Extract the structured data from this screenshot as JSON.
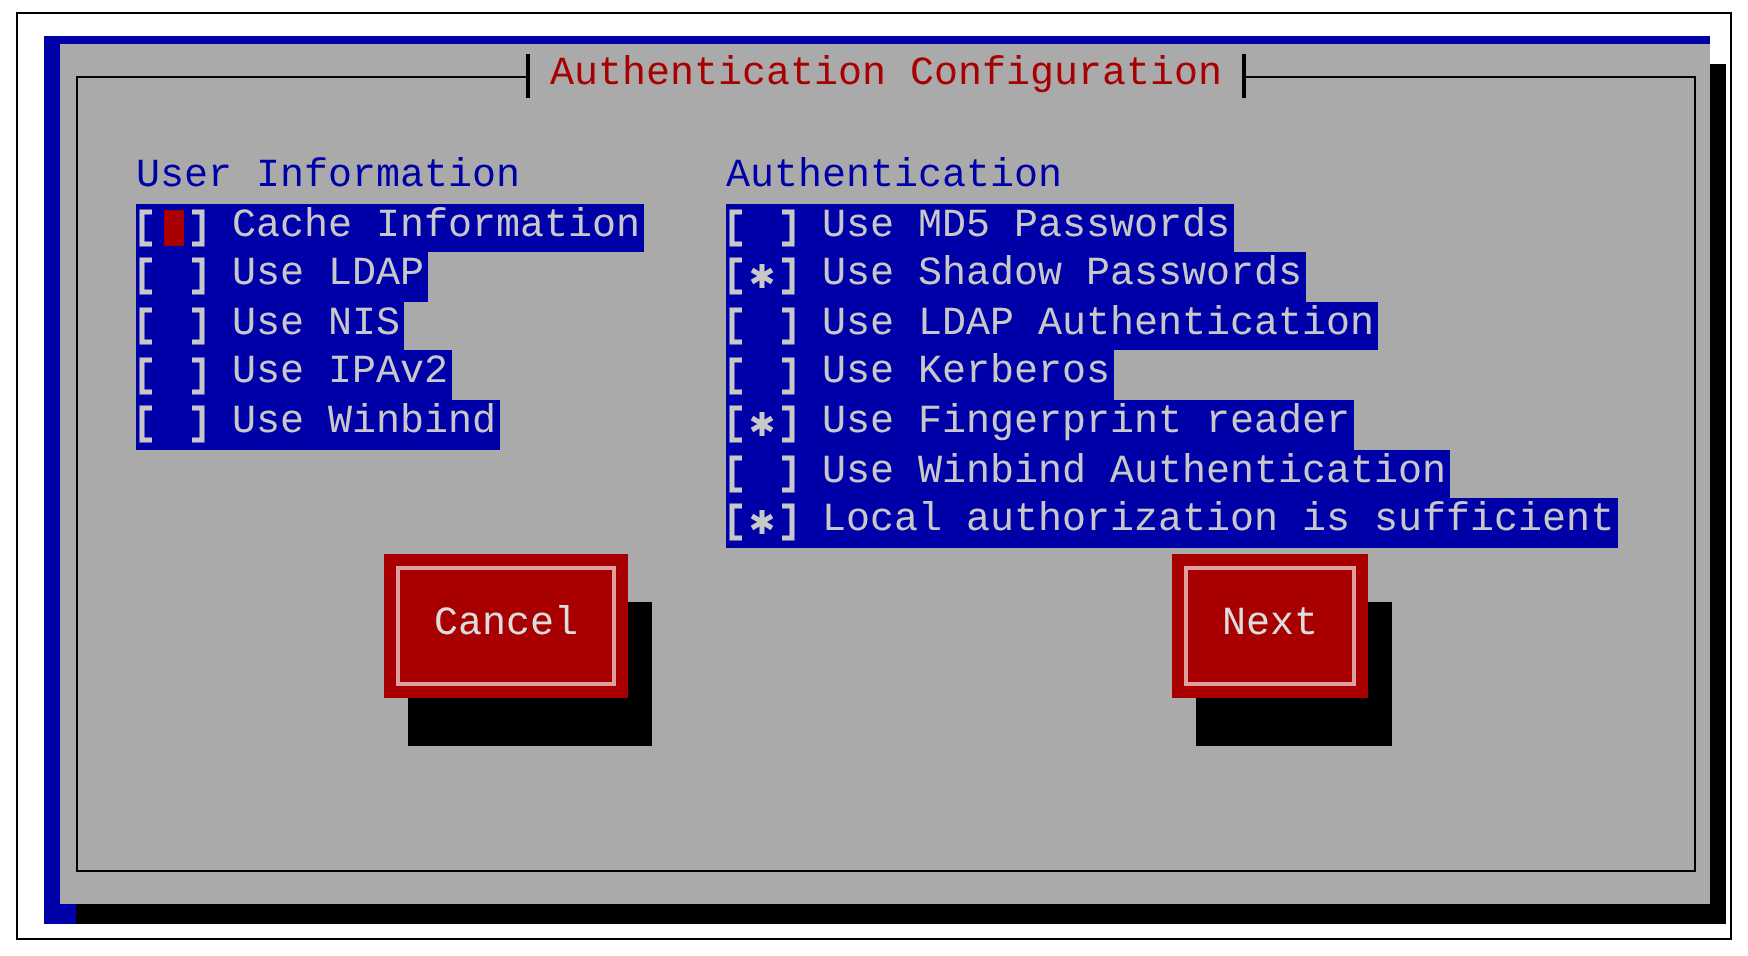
{
  "dialog": {
    "title": "Authentication Configuration",
    "sections": [
      {
        "heading": "User Information",
        "options": [
          {
            "label": "Cache Information",
            "checked": false,
            "focused": true
          },
          {
            "label": "Use LDAP",
            "checked": false,
            "focused": false
          },
          {
            "label": "Use NIS",
            "checked": false,
            "focused": false
          },
          {
            "label": "Use IPAv2",
            "checked": false,
            "focused": false
          },
          {
            "label": "Use Winbind",
            "checked": false,
            "focused": false
          }
        ]
      },
      {
        "heading": "Authentication",
        "options": [
          {
            "label": "Use MD5 Passwords",
            "checked": false,
            "focused": false
          },
          {
            "label": "Use Shadow Passwords",
            "checked": true,
            "focused": false
          },
          {
            "label": "Use LDAP Authentication",
            "checked": false,
            "focused": false
          },
          {
            "label": "Use Kerberos",
            "checked": false,
            "focused": false
          },
          {
            "label": "Use Fingerprint reader",
            "checked": true,
            "focused": false
          },
          {
            "label": "Use Winbind Authentication",
            "checked": false,
            "focused": false
          },
          {
            "label": "Local authorization is sufficient",
            "checked": true,
            "focused": false
          }
        ]
      }
    ],
    "buttons": [
      {
        "label": "Cancel"
      },
      {
        "label": "Next"
      }
    ]
  }
}
